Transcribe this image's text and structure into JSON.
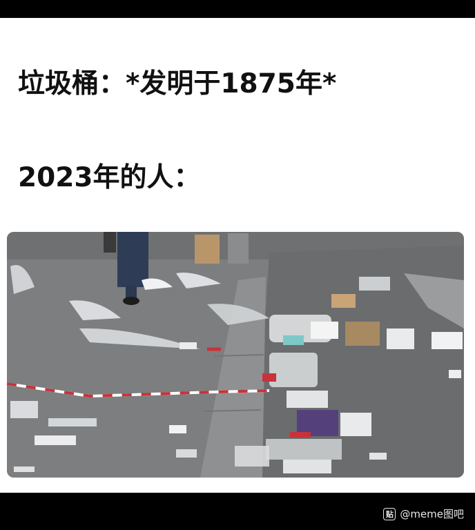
{
  "caption": {
    "line1": "垃圾桶：*发明于1875年*",
    "line2": "2023年的人："
  },
  "photo": {
    "subject": "litter-covered-street",
    "watermark_text": ""
  },
  "footer": {
    "watermark_handle": "@meme图吧",
    "watermark_logo_glyph": "贴"
  },
  "colors": {
    "background": "#000000",
    "card": "#ffffff",
    "text": "#111111",
    "pavement": "#7d7f80",
    "tape_red": "#c8323a"
  }
}
